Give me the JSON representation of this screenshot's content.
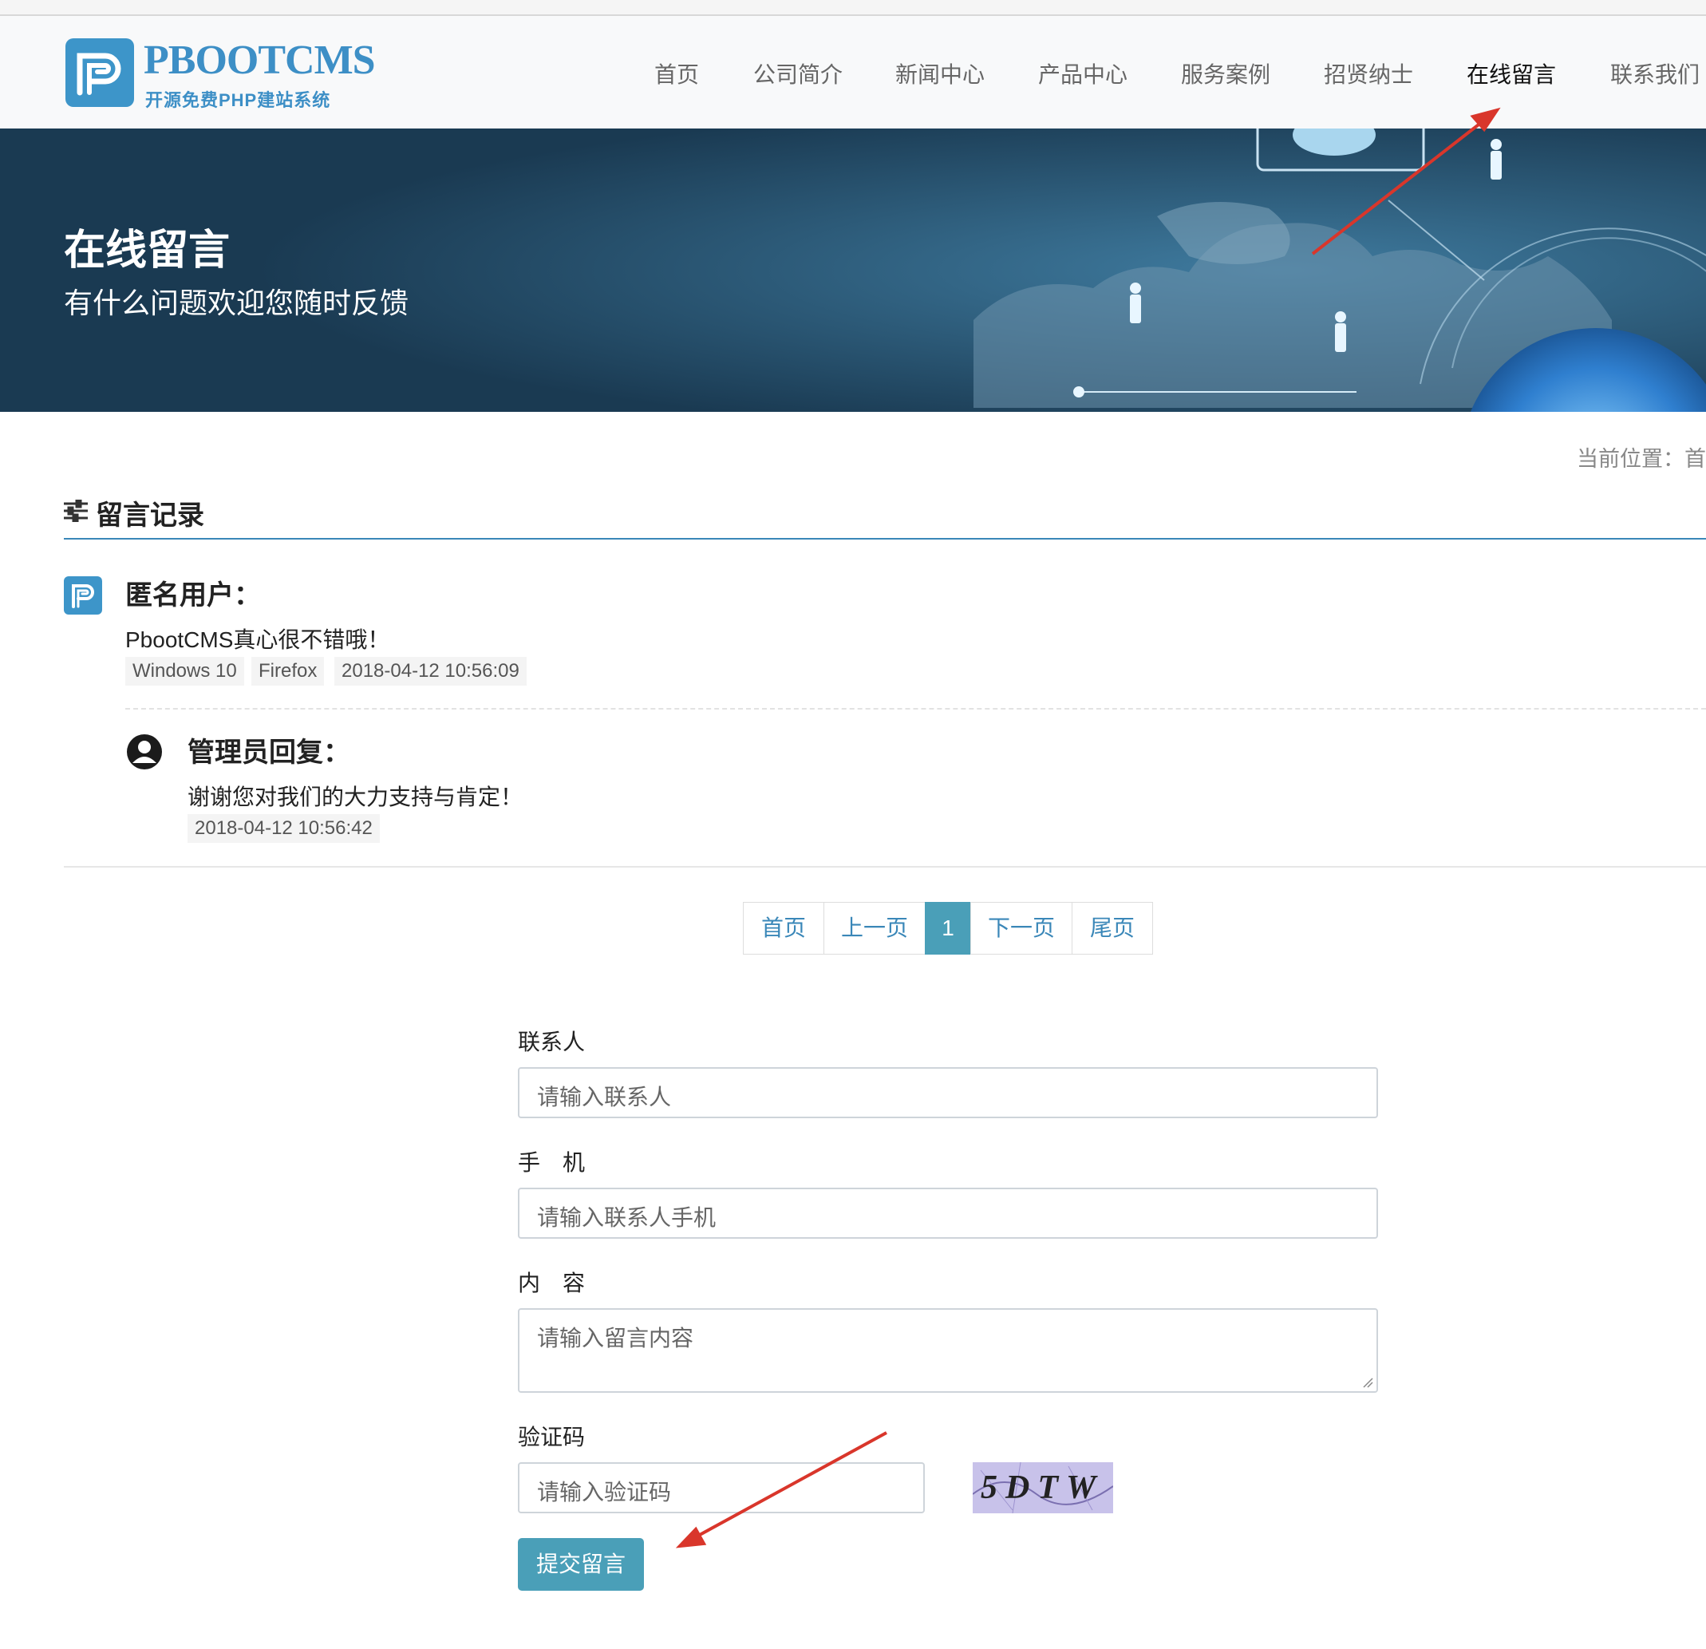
{
  "brand": {
    "name": "PBOOTCMS",
    "tagline": "开源免费PHP建站系统",
    "color": "#3d8fc6"
  },
  "nav": {
    "items": [
      {
        "label": "首页"
      },
      {
        "label": "公司简介"
      },
      {
        "label": "新闻中心"
      },
      {
        "label": "产品中心"
      },
      {
        "label": "服务案例"
      },
      {
        "label": "招贤纳士"
      },
      {
        "label": "在线留言",
        "active": true
      },
      {
        "label": "联系我们"
      }
    ]
  },
  "banner": {
    "title": "在线留言",
    "subtitle": "有什么问题欢迎您随时反馈"
  },
  "breadcrumb": {
    "text": "当前位置：首"
  },
  "section": {
    "title": "留言记录",
    "icon": "sliders-icon"
  },
  "message": {
    "user": "匿名用户：",
    "content": "PbootCMS真心很不错哦！",
    "os": "Windows 10",
    "browser": "Firefox",
    "date": "2018-04-12 10:56:09",
    "reply": {
      "user": "管理员回复：",
      "content": "谢谢您对我们的大力支持与肯定！",
      "date": "2018-04-12 10:56:42"
    }
  },
  "pagination": {
    "first": "首页",
    "prev": "上一页",
    "current": "1",
    "next": "下一页",
    "last": "尾页"
  },
  "form": {
    "contact": {
      "label": "联系人",
      "placeholder": "请输入联系人"
    },
    "mobile": {
      "label": "手　机",
      "placeholder": "请输入联系人手机"
    },
    "content": {
      "label": "内　容",
      "placeholder": "请输入留言内容"
    },
    "captcha": {
      "label": "验证码",
      "placeholder": "请输入验证码",
      "image_text": "5DTW"
    },
    "submit": "提交留言"
  },
  "colors": {
    "accent": "#4a9fb8",
    "link": "#3a87b8",
    "banner": "#1a3a52",
    "annotation_arrow": "#d9362b"
  }
}
